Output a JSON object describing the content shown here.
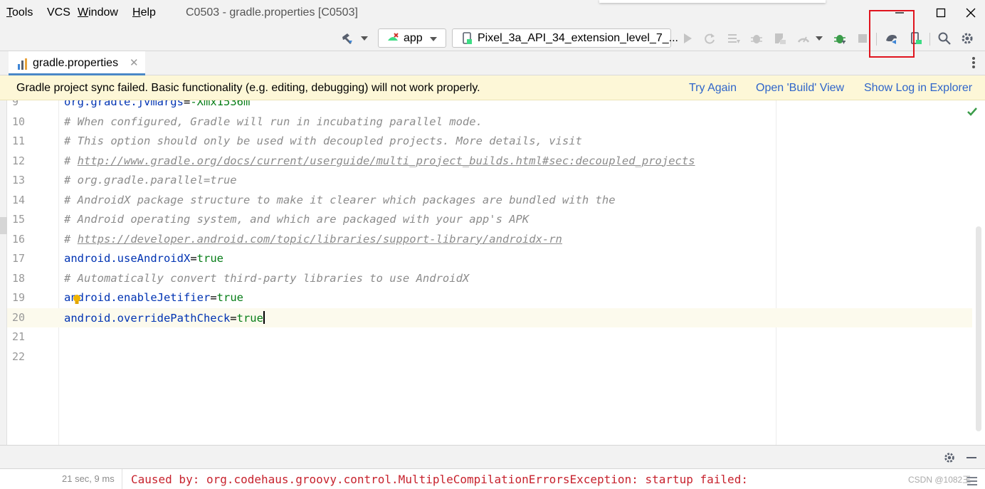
{
  "menu": {
    "tools": {
      "u": "T",
      "rest": "ools"
    },
    "vcs": {
      "u": "",
      "rest": "VCS"
    },
    "window": {
      "u": "W",
      "rest": "indow"
    },
    "help": {
      "u": "H",
      "rest": "elp"
    }
  },
  "window_title": "C0503 - gradle.properties [C0503]",
  "toolbar": {
    "run_config": "app",
    "device": "Pixel_3a_API_34_extension_level_7_..."
  },
  "tabs": [
    {
      "label": "gradle.properties",
      "icon": "gradle-file-icon",
      "active": true
    }
  ],
  "banner": {
    "message": "Gradle project sync failed. Basic functionality (e.g. editing, debugging) will not work properly.",
    "links": [
      "Try Again",
      "Open 'Build' View",
      "Show Log in Explorer"
    ]
  },
  "editor": {
    "lines": [
      {
        "n": "9",
        "type": "kv",
        "key": "org.gradle.jvmargs",
        "value": "-Xmx1536m",
        "partial": true
      },
      {
        "n": "10",
        "type": "comment",
        "text": "# When configured, Gradle will run in incubating parallel mode."
      },
      {
        "n": "11",
        "type": "comment",
        "text": "# This option should only be used with decoupled projects. More details, visit"
      },
      {
        "n": "12",
        "type": "comment-url",
        "prefix": "# ",
        "text": "http://www.gradle.org/docs/current/userguide/multi_project_builds.html#sec:decoupled_projects"
      },
      {
        "n": "13",
        "type": "comment",
        "text": "# org.gradle.parallel=true"
      },
      {
        "n": "14",
        "type": "comment",
        "text": "# AndroidX package structure to make it clearer which packages are bundled with the"
      },
      {
        "n": "15",
        "type": "comment",
        "text": "# Android operating system, and which are packaged with your app's APK"
      },
      {
        "n": "16",
        "type": "comment-url",
        "prefix": "# ",
        "text": "https://developer.android.com/topic/libraries/support-library/androidx-rn"
      },
      {
        "n": "17",
        "type": "kv",
        "key": "android.useAndroidX",
        "value": "true"
      },
      {
        "n": "18",
        "type": "comment",
        "text": "# Automatically convert third-party libraries to use AndroidX"
      },
      {
        "n": "19",
        "type": "kv",
        "key": "android.enableJetifier",
        "value": "true"
      },
      {
        "n": "20",
        "type": "kv",
        "key": "android.overridePathCheck",
        "value": "true",
        "current": true
      },
      {
        "n": "21",
        "type": "empty"
      },
      {
        "n": "22",
        "type": "empty"
      }
    ]
  },
  "console": {
    "time": "21 sec, 9 ms",
    "error": "Caused by: org.codehaus.groovy.control.MultipleCompilationErrorsException: startup failed:",
    "watermark": "CSDN @1082王"
  },
  "colors": {
    "accent": "#4a88c7",
    "banner_bg": "#fdf7d7",
    "link": "#2f65ca",
    "error": "#c7222d",
    "highlight": "#e0141e",
    "comment": "#8c8c8c",
    "key": "#0033b3",
    "value": "#067d17"
  }
}
